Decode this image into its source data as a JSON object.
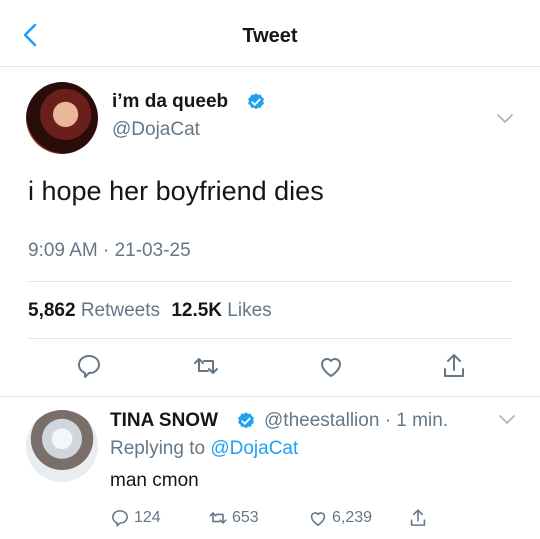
{
  "header": {
    "title": "Tweet",
    "back_icon": "chevron-left-icon",
    "accent": "#1da1f2"
  },
  "tweet": {
    "display_name": "i’m da queeb",
    "handle": "@DojaCat",
    "verified": true,
    "text": "i hope her boyfriend dies",
    "timestamp": "9:09 AM · 21-03-25",
    "retweets_count": "5,862",
    "retweets_label": "Retweets",
    "likes_count": "12.5K",
    "likes_label": "Likes",
    "actions": [
      "reply-icon",
      "retweet-icon",
      "like-icon",
      "share-icon"
    ]
  },
  "reply": {
    "display_name": "TINA SNOW",
    "handle_time": "@theestallion · 1 min.",
    "replying_prefix": "Replying to",
    "replying_to": "@DojaCat",
    "text": "man cmon",
    "reply_count": "124",
    "retweet_count": "653",
    "like_count": "6,239"
  }
}
